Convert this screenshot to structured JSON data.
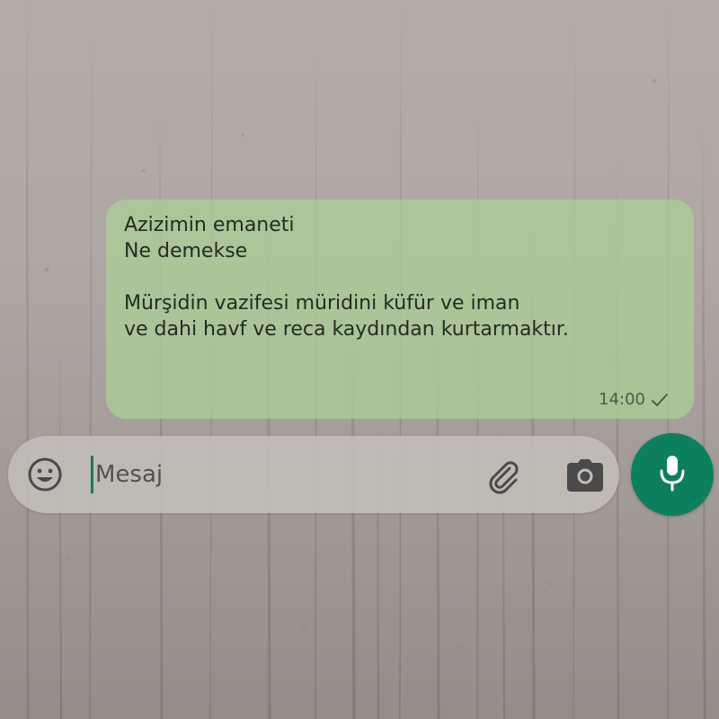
{
  "message": {
    "lines": [
      "Azizimin emaneti",
      "Ne demekse",
      "",
      "Mürşidin vazifesi müridini küfür ve iman",
      "ve dahi havf ve reca kaydından kurtarmaktır."
    ],
    "time": "14:00",
    "status_icon": "single-check-icon"
  },
  "composer": {
    "placeholder": "Mesaj",
    "value": "",
    "emoji_icon": "emoji-icon",
    "attach_icon": "paperclip-icon",
    "camera_icon": "camera-icon",
    "mic_icon": "microphone-icon"
  },
  "colors": {
    "bubble": "#aacd96",
    "mic_button": "#0c7f5e",
    "caret": "#1a7a5e",
    "icon": "#4a4a4a"
  }
}
